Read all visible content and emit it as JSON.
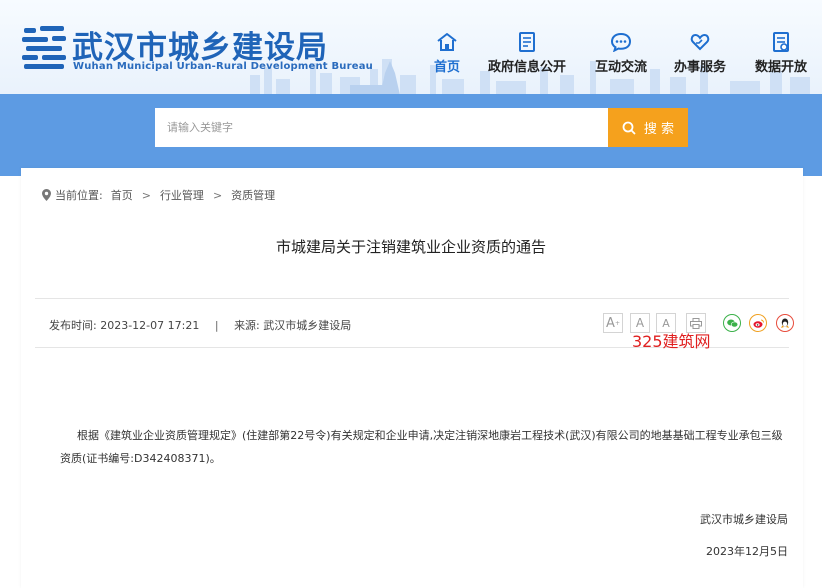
{
  "header": {
    "logo_cn": "武汉市城乡建设局",
    "logo_en": "Wuhan Municipal Urban-Rural Development Bureau"
  },
  "nav": {
    "items": [
      {
        "label": "首页",
        "icon": "home-icon",
        "active": true
      },
      {
        "label": "政府信息公开",
        "icon": "document-icon",
        "active": false
      },
      {
        "label": "互动交流",
        "icon": "chat-icon",
        "active": false
      },
      {
        "label": "办事服务",
        "icon": "heart-hand-icon",
        "active": false
      },
      {
        "label": "数据开放",
        "icon": "data-file-icon",
        "active": false
      }
    ]
  },
  "search": {
    "placeholder": "请输入关键字",
    "button_label": "搜 索"
  },
  "breadcrumb": {
    "prefix": "当前位置:",
    "items": [
      "首页",
      "行业管理",
      "资质管理"
    ],
    "separator": ">"
  },
  "article": {
    "title": "市城建局关于注销建筑业企业资质的通告",
    "publish_label": "发布时间:",
    "publish_time": "2023-12-07 17:21",
    "meta_separator": "|",
    "source_label": "来源:",
    "source": "武汉市城乡建设局",
    "body": "根据《建筑业企业资质管理规定》(住建部第22号令)有关规定和企业申请,决定注销深地康岩工程技术(武汉)有限公司的地基基础工程专业承包三级资质(证书编号:D342408371)。",
    "signature_org": "武汉市城乡建设局",
    "signature_date": "2023年12月5日"
  },
  "toolbar": {
    "font_large": "A",
    "font_medium": "A",
    "font_small": "A",
    "print_icon": "printer-icon",
    "share_icons": [
      "wechat-icon",
      "weibo-icon",
      "qq-icon"
    ]
  },
  "watermark": "325建筑网",
  "colors": {
    "brand_blue": "#1f64b8",
    "band_blue": "#5d9be3",
    "search_orange": "#f5a11d",
    "active_nav": "#1f6fd0",
    "watermark_red": "#e02020"
  }
}
